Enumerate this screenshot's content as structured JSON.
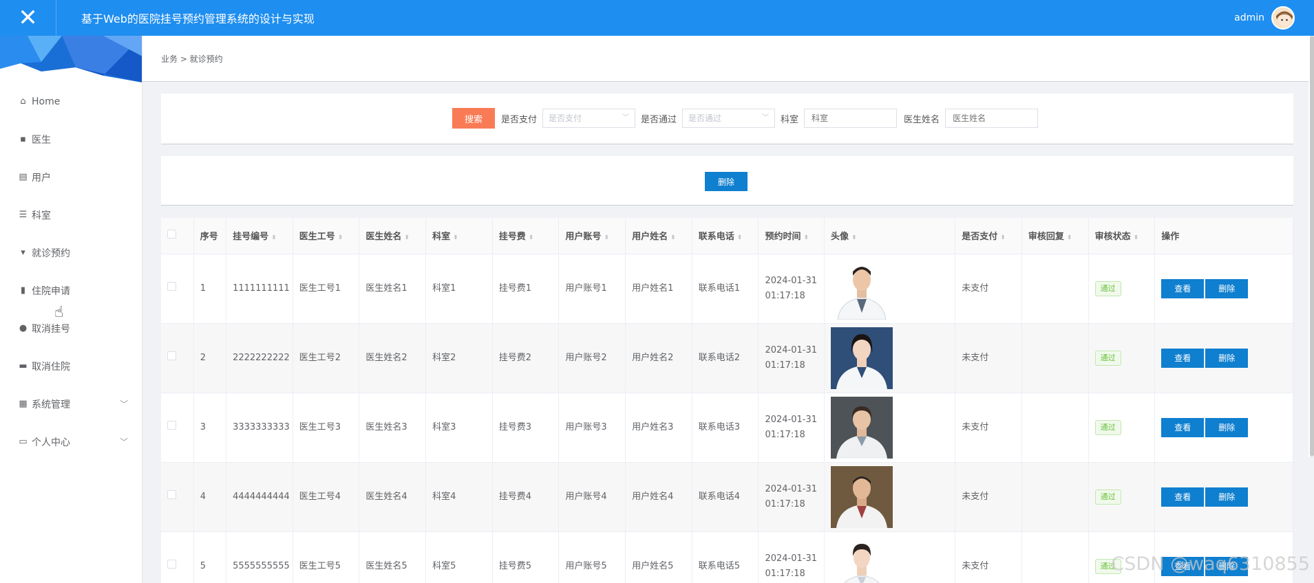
{
  "header": {
    "close_icon": "close-icon",
    "title": "基于Web的医院挂号预约管理系统的设计与实现",
    "user": "admin"
  },
  "sidebar": {
    "items": [
      {
        "label": "Home",
        "icon": "home-icon",
        "glyph": "⌂"
      },
      {
        "label": "医生",
        "icon": "comment-icon",
        "glyph": "▪"
      },
      {
        "label": "用户",
        "icon": "clipboard-icon",
        "glyph": "▤"
      },
      {
        "label": "科室",
        "icon": "sliders-icon",
        "glyph": "☰"
      },
      {
        "label": "就诊预约",
        "icon": "stamp-icon",
        "glyph": "▾"
      },
      {
        "label": "住院申请",
        "icon": "bar-chart-icon",
        "glyph": "▮"
      },
      {
        "label": "取消挂号",
        "icon": "pin-icon",
        "glyph": "●"
      },
      {
        "label": "取消住院",
        "icon": "briefcase-icon",
        "glyph": "▬"
      },
      {
        "label": "系统管理",
        "icon": "folder-icon",
        "glyph": "▦",
        "expandable": true
      },
      {
        "label": "个人中心",
        "icon": "calendar-icon",
        "glyph": "▭",
        "expandable": true
      }
    ]
  },
  "breadcrumb": {
    "text": "业务 > 就诊预约"
  },
  "search": {
    "button": "搜索",
    "paid_label": "是否支付",
    "paid_placeholder": "是否支付",
    "approved_label": "是否通过",
    "approved_placeholder": "是否通过",
    "dept_label": "科室",
    "dept_placeholder": "科室",
    "doctor_label": "医生姓名",
    "doctor_placeholder": "医生姓名"
  },
  "actions": {
    "delete": "删除"
  },
  "table": {
    "columns": [
      "序号",
      "挂号编号",
      "医生工号",
      "医生姓名",
      "科室",
      "挂号费",
      "用户账号",
      "用户姓名",
      "联系电话",
      "预约时间",
      "头像",
      "是否支付",
      "审核回复",
      "审核状态",
      "操作"
    ],
    "rows": [
      {
        "idx": "1",
        "reg_no": "1111111111",
        "doc_id": "医生工号1",
        "doc_name": "医生姓名1",
        "dept": "科室1",
        "fee": "挂号费1",
        "account": "用户账号1",
        "user_name": "用户姓名1",
        "phone": "联系电话1",
        "time": "2024-01-31 01:17:18",
        "paid": "未支付",
        "reply": "",
        "status": "通过",
        "view": "查看",
        "del": "删除"
      },
      {
        "idx": "2",
        "reg_no": "2222222222",
        "doc_id": "医生工号2",
        "doc_name": "医生姓名2",
        "dept": "科室2",
        "fee": "挂号费2",
        "account": "用户账号2",
        "user_name": "用户姓名2",
        "phone": "联系电话2",
        "time": "2024-01-31 01:17:18",
        "paid": "未支付",
        "reply": "",
        "status": "通过",
        "view": "查看",
        "del": "删除"
      },
      {
        "idx": "3",
        "reg_no": "3333333333",
        "doc_id": "医生工号3",
        "doc_name": "医生姓名3",
        "dept": "科室3",
        "fee": "挂号费3",
        "account": "用户账号3",
        "user_name": "用户姓名3",
        "phone": "联系电话3",
        "time": "2024-01-31 01:17:18",
        "paid": "未支付",
        "reply": "",
        "status": "通过",
        "view": "查看",
        "del": "删除"
      },
      {
        "idx": "4",
        "reg_no": "4444444444",
        "doc_id": "医生工号4",
        "doc_name": "医生姓名4",
        "dept": "科室4",
        "fee": "挂号费4",
        "account": "用户账号4",
        "user_name": "用户姓名4",
        "phone": "联系电话4",
        "time": "2024-01-31 01:17:18",
        "paid": "未支付",
        "reply": "",
        "status": "通过",
        "view": "查看",
        "del": "删除"
      },
      {
        "idx": "5",
        "reg_no": "5555555555",
        "doc_id": "医生工号5",
        "doc_name": "医生姓名5",
        "dept": "科室5",
        "fee": "挂号费5",
        "account": "用户账号5",
        "user_name": "用户姓名5",
        "phone": "联系电话5",
        "time": "2024-01-31 01:17:18",
        "paid": "未支付",
        "reply": "",
        "status": "通过",
        "view": "查看",
        "del": "删除"
      }
    ]
  },
  "watermark": "CSDN @waq6310855",
  "colors": {
    "topbar": "#1e8ef0",
    "search_btn": "#f97b55",
    "primary_btn": "#0f7fcf",
    "tag_green": "#67c23a"
  }
}
